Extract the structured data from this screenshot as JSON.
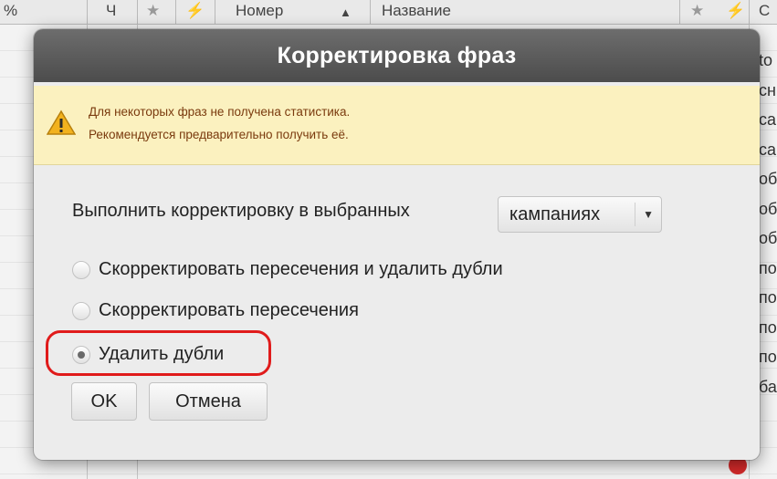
{
  "background": {
    "header": {
      "col1": "%",
      "col2": "Ч",
      "col3": "Номер",
      "sort_indicator": "▲",
      "col4": "Название",
      "right_col": "С"
    },
    "right_cells": [
      "to",
      "сн",
      "са",
      "са",
      "об",
      "об",
      "об",
      "по",
      "по",
      "по",
      "по",
      "ба"
    ]
  },
  "dialog": {
    "title": "Корректировка фраз",
    "warning": {
      "line1": "Для некоторых фраз не получена статистика.",
      "line2": "Рекомендуется предварительно получить её."
    },
    "scope_label": "Выполнить корректировку в выбранных",
    "scope_select_value": "кампаниях",
    "options": [
      {
        "label": "Скорректировать пересечения и удалить дубли",
        "checked": false
      },
      {
        "label": "Скорректировать пересечения",
        "checked": false
      },
      {
        "label": "Удалить дубли",
        "checked": true
      }
    ],
    "ok_label": "OK",
    "cancel_label": "Отмена"
  },
  "colors": {
    "title_bar": "#4c4c4c",
    "warning_bg": "#fbf1bf",
    "warning_text": "#7a3a0e",
    "highlight": "#e01b1b"
  }
}
